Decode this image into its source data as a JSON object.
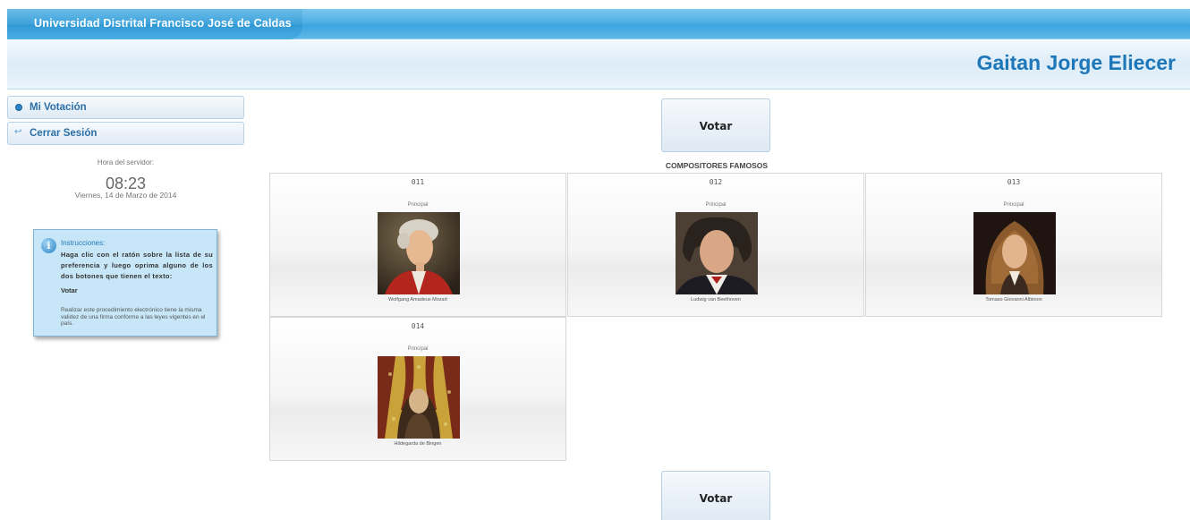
{
  "topbar": {
    "title": "Universidad Distrital Francisco José de Caldas"
  },
  "header": {
    "user_name": "Gaitan Jorge Eliecer"
  },
  "sidebar": {
    "items": [
      {
        "label": "Mi Votación",
        "icon": "bullet-icon"
      },
      {
        "label": "Cerrar Sesión",
        "icon": "arrow-icon"
      }
    ],
    "server_label": "Hora del servidor:",
    "server_time": "08:23",
    "server_date": "Viernes, 14 de Marzo de 2014"
  },
  "instructions": {
    "title": "Instrucciones:",
    "text": "Haga clic con el ratón sobre la lista de su preferencia y luego oprima alguno de los dos botones que tienen el texto:",
    "vote_word": "Votar",
    "note": "Realizar este procedimiento electrónico tiene la misma validez de una firma conforme a las leyes vigentes en el país."
  },
  "vote_button_label": "Votar",
  "group_title": "COMPOSITORES FAMOSOS",
  "candidates": [
    {
      "code": "011",
      "role": "Principal",
      "name": "Wolfgang Amadeus Mozart"
    },
    {
      "code": "012",
      "role": "Principal",
      "name": "Ludwig van Beethoven"
    },
    {
      "code": "013",
      "role": "Principal",
      "name": "Tomaso Giovanni Albinoni"
    },
    {
      "code": "014",
      "role": "Principal",
      "name": "Hildegarda de Bingen"
    }
  ]
}
